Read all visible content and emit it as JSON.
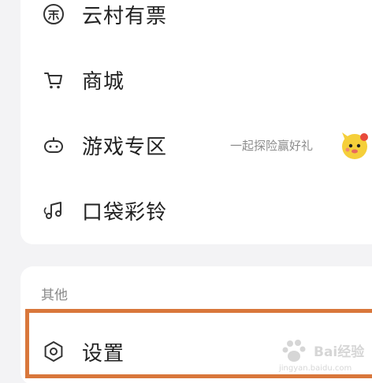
{
  "menu": {
    "items": [
      {
        "label": "云村有票",
        "icon": "ticket-icon"
      },
      {
        "label": "商城",
        "icon": "cart-icon"
      },
      {
        "label": "游戏专区",
        "icon": "gamepad-icon",
        "promo": "一起探险赢好礼"
      },
      {
        "label": "口袋彩铃",
        "icon": "music-note-icon"
      }
    ]
  },
  "other_section": {
    "header": "其他",
    "settings_label": "设置",
    "settings_icon": "settings-hexagon-icon"
  },
  "watermark": {
    "brand": "Bai",
    "suffix": "经验",
    "url": "jingyan.baidu.com"
  },
  "colors": {
    "highlight": "#d9773b",
    "background": "#f3f3f5",
    "card": "#ffffff",
    "text": "#222222",
    "badge": "#e84a3c"
  }
}
